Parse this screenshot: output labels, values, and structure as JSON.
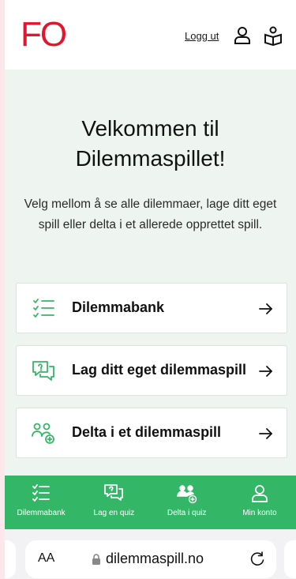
{
  "header": {
    "logo": "FO",
    "logout_label": "Logg ut",
    "icons": [
      "user-icon",
      "book-reader-icon"
    ]
  },
  "main": {
    "title": "Velkommen til Dilemmaspillet!",
    "intro": "Velg mellom å se alle dilemmaer, lage ditt eget spill eller delta i et allerede opprettet spill.",
    "cards": [
      {
        "label": "Dilemmabank",
        "icon": "checklist-icon"
      },
      {
        "label": "Lag ditt eget dilemmaspill",
        "icon": "chat-question-icon"
      },
      {
        "label": "Delta i et dilemmaspill",
        "icon": "group-add-icon"
      }
    ]
  },
  "bottom_nav": {
    "items": [
      {
        "label": "Dilemmabank",
        "icon": "checklist-icon"
      },
      {
        "label": "Lag en quiz",
        "icon": "chat-question-icon"
      },
      {
        "label": "Delta i quiz",
        "icon": "group-add-icon"
      },
      {
        "label": "Min konto",
        "icon": "user-icon"
      }
    ]
  },
  "browser": {
    "text_size_label": "AA",
    "url": "dilemmaspill.no"
  },
  "colors": {
    "brand_red": "#e3142c",
    "accent_green": "#34b667",
    "background_tint": "#eef5f0"
  }
}
